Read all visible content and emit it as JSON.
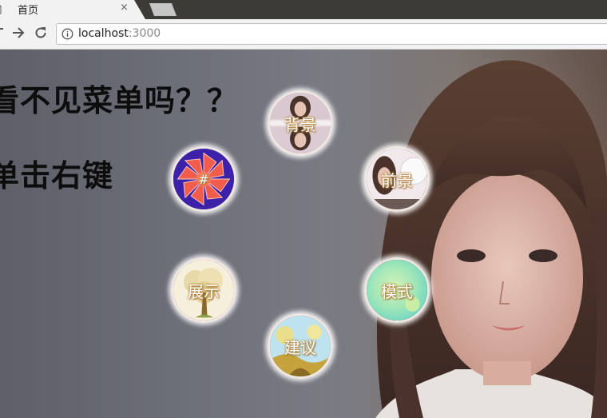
{
  "browser": {
    "tab_title": "首页",
    "tab_close": "×",
    "url_host": "localhost",
    "url_port": ":3000"
  },
  "page": {
    "headline_1": "看不见菜单吗？？",
    "headline_2": "单击右键"
  },
  "menu": {
    "background": "背景",
    "foreground": "前景",
    "showcase": "展示",
    "mode": "模式",
    "suggest": "建议",
    "hash": "#"
  },
  "colors": {
    "chrome": "#f2f2f2",
    "titlebar": "#3c3b37",
    "heading": "#0d0d0d",
    "label_glow": "#b8863a"
  }
}
